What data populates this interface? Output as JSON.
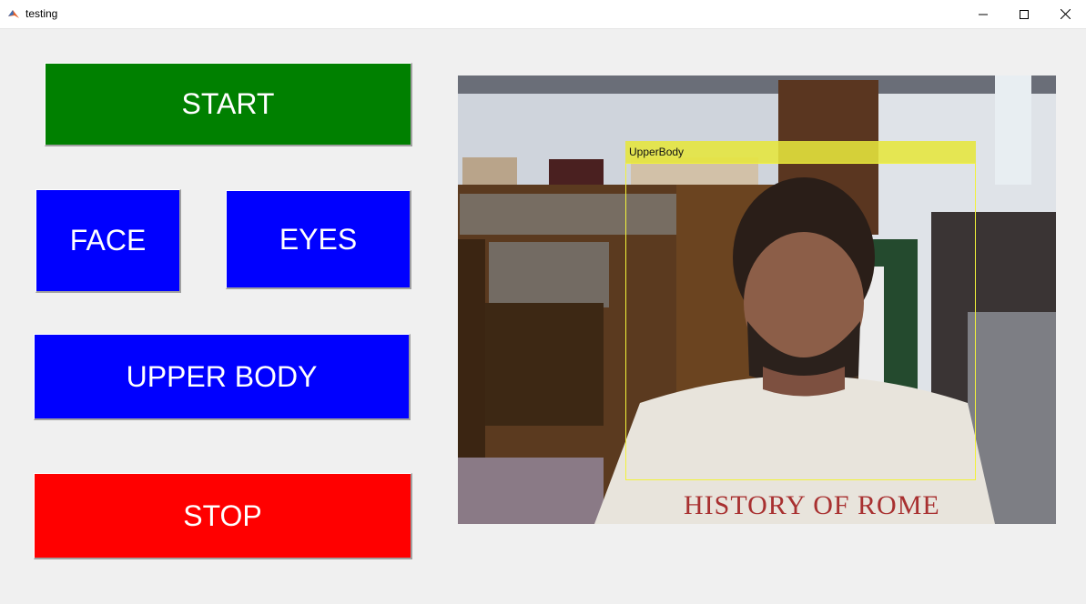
{
  "window": {
    "title": "testing"
  },
  "buttons": {
    "start": "START",
    "face": "FACE",
    "eyes": "EYES",
    "upper_body": "UPPER BODY",
    "stop": "STOP"
  },
  "detection": {
    "label": "UpperBody"
  },
  "scene": {
    "shirt_text": "HISTORY OF ROME"
  },
  "colors": {
    "start": "#008000",
    "face": "#0000ff",
    "stop": "#ff0000",
    "detection": "#f2f23a"
  }
}
